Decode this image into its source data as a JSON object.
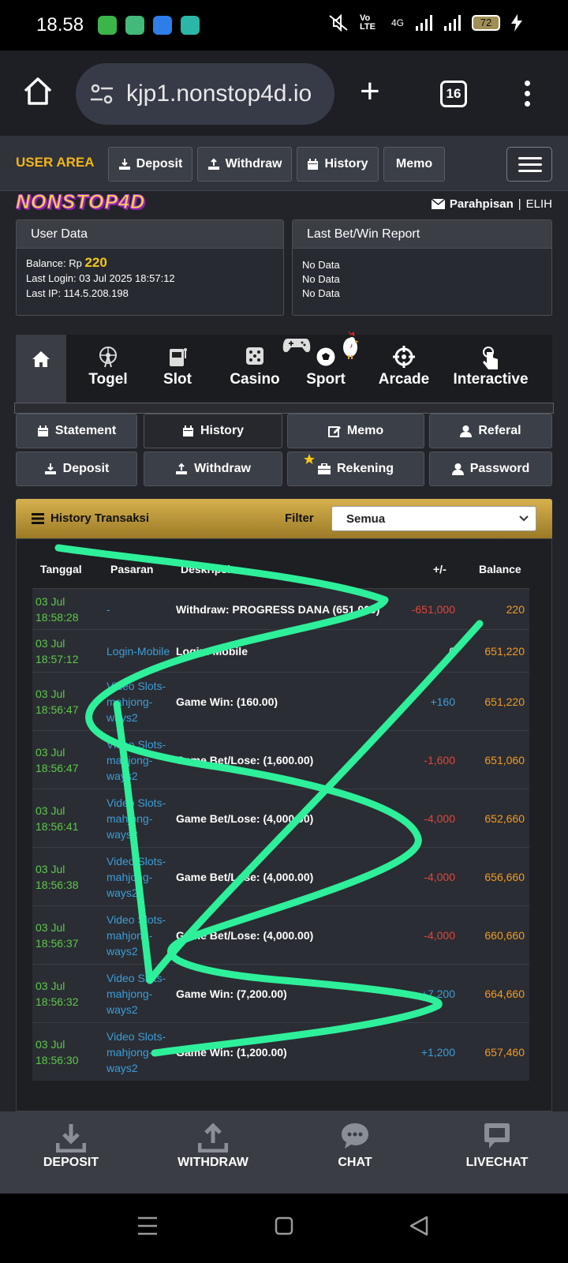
{
  "status": {
    "time": "18.58",
    "network": "4G",
    "volte": "Vo LTE",
    "battery": "72"
  },
  "browser": {
    "url": "kjp1.nonstop4d.io",
    "tab_count": "16"
  },
  "topnav": {
    "user_area": "USER AREA",
    "deposit": "Deposit",
    "withdraw": "Withdraw",
    "history": "History",
    "memo": "Memo"
  },
  "brand": {
    "logo_text": "NONSTOP4D",
    "username": "Parahpisan",
    "separator": "|",
    "level": "ELIH"
  },
  "user_data": {
    "title": "User Data",
    "balance_label": "Balance: Rp",
    "balance_value": "220",
    "last_login": "Last Login: 03 Jul 2025 18:57:12",
    "last_ip": "Last IP: 114.5.208.198"
  },
  "last_bet": {
    "title": "Last Bet/Win Report",
    "lines": [
      "No Data",
      "No Data",
      "No Data"
    ]
  },
  "categories": [
    "Togel",
    "Slot",
    "Casino",
    "Sport",
    "Arcade",
    "Interactive"
  ],
  "subnav": {
    "statement": "Statement",
    "history": "History",
    "memo": "Memo",
    "referal": "Referal",
    "deposit": "Deposit",
    "withdraw": "Withdraw",
    "rekening": "Rekening",
    "password": "Password"
  },
  "history": {
    "title": "History Transaksi",
    "filter_label": "Filter",
    "filter_value": "Semua",
    "columns": {
      "tanggal": "Tanggal",
      "pasaran": "Pasaran",
      "deskripsi": "Deskripsi",
      "amount": "+/-",
      "balance": "Balance"
    },
    "rows": [
      {
        "date": "03 Jul",
        "time": "18:58:28",
        "pasaran": [
          "-"
        ],
        "desc": "Withdraw: PROGRESS DANA (651,000)",
        "amount": "-651,000",
        "sign": "neg",
        "balance": "220"
      },
      {
        "date": "03 Jul",
        "time": "18:57:12",
        "pasaran": [
          "Login-Mobile"
        ],
        "desc": "Login: Mobile",
        "amount": "0",
        "sign": "zero",
        "balance": "651,220"
      },
      {
        "date": "03 Jul",
        "time": "18:56:47",
        "pasaran": [
          "Video Slots-",
          "mahjong-",
          "ways2"
        ],
        "desc": "Game Win: (160.00)",
        "amount": "+160",
        "sign": "pos",
        "balance": "651,220"
      },
      {
        "date": "03 Jul",
        "time": "18:56:47",
        "pasaran": [
          "Video Slots-",
          "mahjong-",
          "ways2"
        ],
        "desc": "Game Bet/Lose: (1,600.00)",
        "amount": "-1,600",
        "sign": "neg",
        "balance": "651,060"
      },
      {
        "date": "03 Jul",
        "time": "18:56:41",
        "pasaran": [
          "Video Slots-",
          "mahjong-",
          "ways2"
        ],
        "desc": "Game Bet/Lose: (4,000.00)",
        "amount": "-4,000",
        "sign": "neg",
        "balance": "652,660"
      },
      {
        "date": "03 Jul",
        "time": "18:56:38",
        "pasaran": [
          "Video Slots-",
          "mahjong-",
          "ways2"
        ],
        "desc": "Game Bet/Lose: (4,000.00)",
        "amount": "-4,000",
        "sign": "neg",
        "balance": "656,660"
      },
      {
        "date": "03 Jul",
        "time": "18:56:37",
        "pasaran": [
          "Video Slots-",
          "mahjong-",
          "ways2"
        ],
        "desc": "Game Bet/Lose: (4,000.00)",
        "amount": "-4,000",
        "sign": "neg",
        "balance": "660,660"
      },
      {
        "date": "03 Jul",
        "time": "18:56:32",
        "pasaran": [
          "Video Slots-",
          "mahjong-",
          "ways2"
        ],
        "desc": "Game Win: (7,200.00)",
        "amount": "+7,200",
        "sign": "pos",
        "balance": "664,660"
      },
      {
        "date": "03 Jul",
        "time": "18:56:30",
        "pasaran": [
          "Video Slots-",
          "mahjong-",
          "ways2"
        ],
        "desc": "Game Win: (1,200.00)",
        "amount": "+1,200",
        "sign": "pos",
        "balance": "657,460"
      }
    ]
  },
  "bottom_tabs": {
    "deposit": "DEPOSIT",
    "withdraw": "WITHDRAW",
    "chat": "CHAT",
    "livechat": "LIVECHAT"
  },
  "colors": {
    "accent_gold": "#f3b519",
    "positive": "#3d9dd9",
    "negative": "#e0463d",
    "date_green": "#5ec84a",
    "balance_orange": "#f29b25",
    "scribble": "#2ef09a"
  }
}
